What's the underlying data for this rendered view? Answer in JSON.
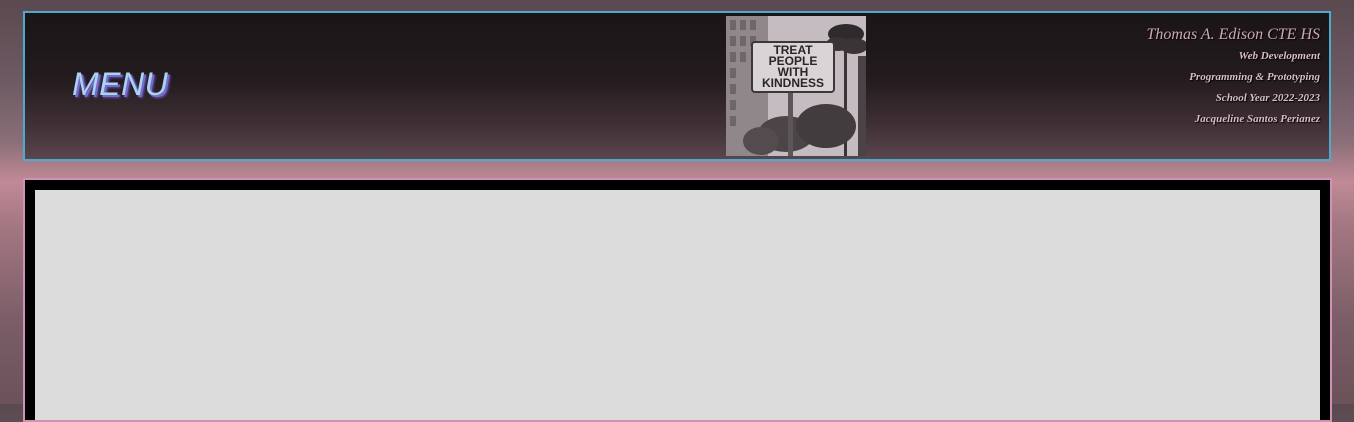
{
  "header": {
    "menu_label": "MENU",
    "photo_sign": {
      "line1": "TREAT",
      "line2": "PEOPLE",
      "line3": "WITH",
      "line4": "KINDNESS"
    },
    "info": {
      "school": "Thomas A. Edison CTE HS",
      "course": "Web Development",
      "subject": "Programming & Prototyping",
      "year": "School Year 2022-2023",
      "author": "Jacqueline Santos Perianez"
    }
  },
  "colors": {
    "header_border": "#4ea9cf",
    "main_border": "#cf92b6",
    "menu_text": "#a8d3f3",
    "content_background": "#dcdcdc"
  }
}
